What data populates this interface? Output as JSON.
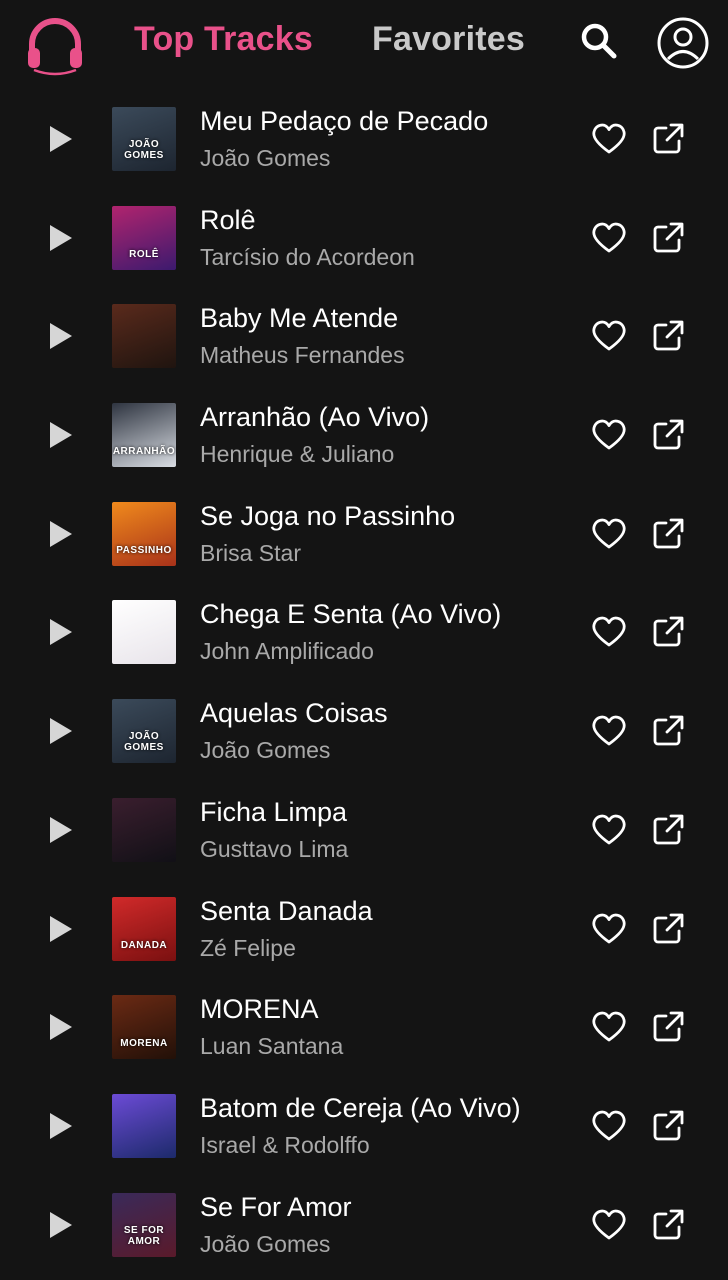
{
  "header": {
    "tabs": [
      {
        "label": "Top Tracks",
        "active": true
      },
      {
        "label": "Favorites",
        "active": false
      }
    ],
    "icons": {
      "logo": "headphones-icon",
      "search": "search-icon",
      "account": "account-icon"
    },
    "accent_color": "#e9518a"
  },
  "tracks": [
    {
      "title": "Meu Pedaço de Pecado",
      "artist": "João Gomes",
      "cover_colors": [
        "#3b4a5a",
        "#1d2530"
      ],
      "cover_text": "JOÃO GOMES"
    },
    {
      "title": "Rolê",
      "artist": "Tarcísio do Acordeon",
      "cover_colors": [
        "#b1246e",
        "#3c1a6e"
      ],
      "cover_text": "ROLÊ"
    },
    {
      "title": "Baby Me Atende",
      "artist": "Matheus Fernandes",
      "cover_colors": [
        "#5a2a1c",
        "#1f140f"
      ],
      "cover_text": ""
    },
    {
      "title": "Arranhão (Ao Vivo)",
      "artist": "Henrique & Juliano",
      "cover_colors": [
        "#2e3440",
        "#d9dde3"
      ],
      "cover_text": "ARRANHÃO"
    },
    {
      "title": "Se Joga no Passinho",
      "artist": "Brisa Star",
      "cover_colors": [
        "#f08a1c",
        "#a8321a"
      ],
      "cover_text": "PASSINHO"
    },
    {
      "title": "Chega E Senta (Ao Vivo)",
      "artist": "John Amplificado",
      "cover_colors": [
        "#ffffff",
        "#e8e4ea"
      ],
      "cover_text": ""
    },
    {
      "title": "Aquelas Coisas",
      "artist": "João Gomes",
      "cover_colors": [
        "#3b4a5a",
        "#1d2530"
      ],
      "cover_text": "JOÃO GOMES"
    },
    {
      "title": "Ficha Limpa",
      "artist": "Gusttavo Lima",
      "cover_colors": [
        "#3a1e2e",
        "#111016"
      ],
      "cover_text": ""
    },
    {
      "title": "Senta Danada",
      "artist": "Zé Felipe",
      "cover_colors": [
        "#d12a2a",
        "#7a1010"
      ],
      "cover_text": "DANADA"
    },
    {
      "title": "MORENA",
      "artist": "Luan Santana",
      "cover_colors": [
        "#6b2a14",
        "#221008"
      ],
      "cover_text": "MORENA"
    },
    {
      "title": "Batom de Cereja (Ao Vivo)",
      "artist": "Israel & Rodolffo",
      "cover_colors": [
        "#6c4bd6",
        "#1c2a6a"
      ],
      "cover_text": ""
    },
    {
      "title": "Se For Amor",
      "artist": "João Gomes",
      "cover_colors": [
        "#3a2a5a",
        "#5a1a2a"
      ],
      "cover_text": "SE FOR AMOR"
    }
  ]
}
